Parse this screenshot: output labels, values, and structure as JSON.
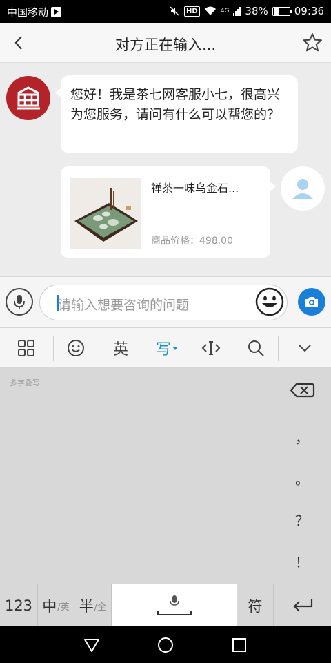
{
  "status_bar": {
    "carrier": "中国移动",
    "network_tag": "4G",
    "hd_badge": "HD",
    "battery_percent": "38%",
    "battery_level": 0.38,
    "time": "09:36"
  },
  "header": {
    "back_icon": "chevron-left-icon",
    "title": "对方正在输入...",
    "favorite_icon": "star-outline-icon"
  },
  "chat": {
    "agent_message": "您好！我是茶七网客服小七，很高兴为您服务，请问有什么可以帮您的？",
    "product": {
      "name": "禅茶一味乌金石...",
      "price_label": "商品价格：",
      "price_value": "498.00"
    }
  },
  "input_bar": {
    "placeholder": "请输入想要咨询的问题",
    "voice_icon": "microphone-icon",
    "emoji_icon": "smiley-icon",
    "camera_icon": "camera-icon"
  },
  "ime_toolbar": {
    "menu_icon": "grid-icon",
    "emoji_icon": "smiley-icon",
    "english_label": "英",
    "write_label": "写",
    "cursor_icon": "cursor-move-icon",
    "search_icon": "search-icon",
    "collapse_icon": "chevron-down-icon"
  },
  "handwriting": {
    "hint": "多字叠写",
    "punctuation": [
      "，",
      "。",
      "？",
      "！"
    ]
  },
  "key_row": {
    "numbers": "123",
    "chinese_main": "中",
    "chinese_sub": "/英",
    "half_main": "半",
    "half_sub": "/全",
    "symbols": "符"
  },
  "colors": {
    "accent": "#1a7fd8",
    "brand_red": "#b5232a",
    "ime_accent": "#1a8fd0"
  }
}
